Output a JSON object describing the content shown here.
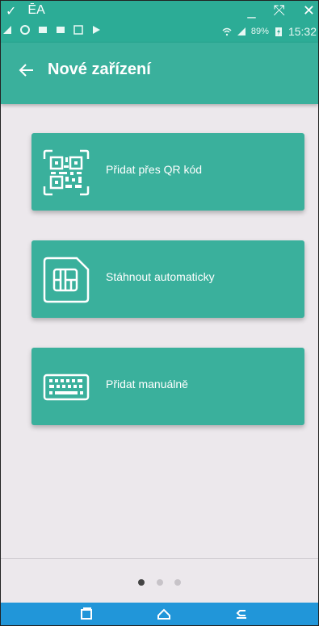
{
  "window": {
    "caption_left_1": "✓",
    "caption_left_2": "ĒA",
    "minimize": "_",
    "restore": "✕",
    "close": "✕"
  },
  "status_bar": {
    "battery": "89%",
    "time": "15:32"
  },
  "app_bar": {
    "title": "Nové zařízení"
  },
  "options": [
    {
      "label": "Přidat přes QR kód",
      "icon": "qr-code-icon"
    },
    {
      "label": "Stáhnout automaticky",
      "icon": "sim-card-icon"
    },
    {
      "label": "Přidat manuálně",
      "icon": "keyboard-icon"
    }
  ],
  "pager": {
    "count": 3,
    "active": 1
  },
  "colors": {
    "accent": "#3ab09c",
    "status_bar": "#2cac96",
    "background": "#ece8ec",
    "nav_bar": "#2196d9"
  }
}
